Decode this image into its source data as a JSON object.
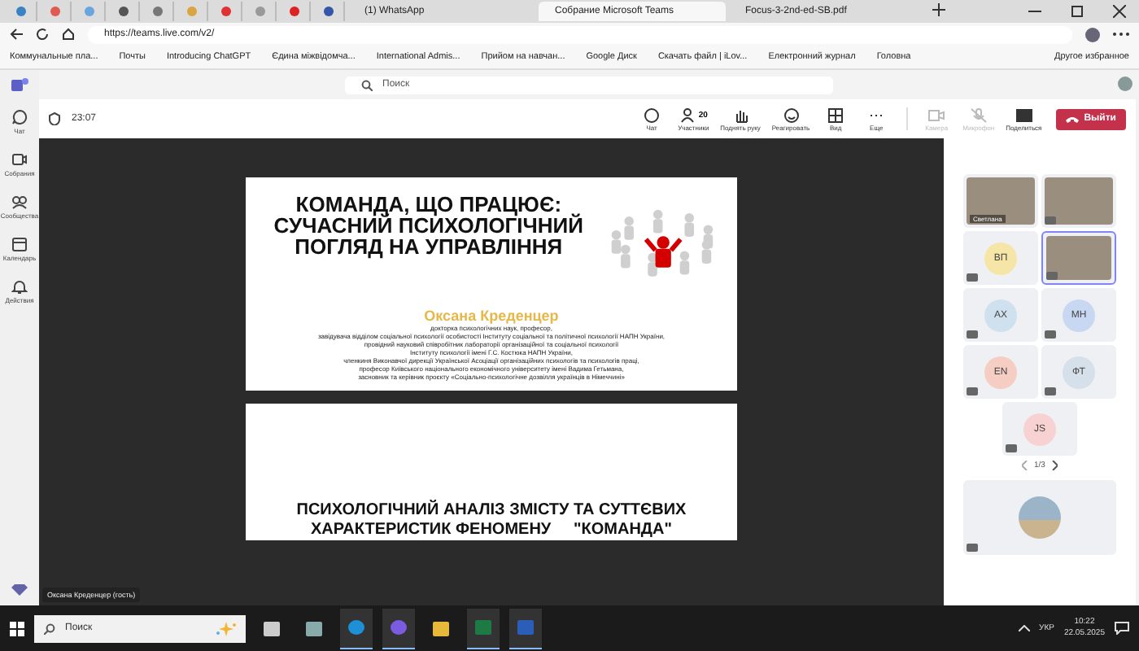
{
  "browser": {
    "tabs": [
      {
        "kind": "pinned",
        "selected": false
      },
      {
        "kind": "pinned",
        "selected": false
      },
      {
        "kind": "pinned",
        "selected": false
      },
      {
        "kind": "pinned",
        "selected": false
      },
      {
        "kind": "pinned",
        "selected": false
      },
      {
        "kind": "pinned",
        "selected": false
      },
      {
        "kind": "pinned",
        "selected": false
      },
      {
        "kind": "pinned",
        "selected": false
      },
      {
        "kind": "pinned",
        "selected": false
      },
      {
        "kind": "pinned",
        "selected": false
      },
      {
        "kind": "page",
        "label": "(1) WhatsApp",
        "selected": false
      },
      {
        "kind": "page",
        "label": "Собрание Microsoft Teams",
        "selected": true
      },
      {
        "kind": "page",
        "label": "Focus-3-2nd-ed-SB.pdf",
        "selected": false
      }
    ],
    "address": "https://teams.live.com/v2/",
    "bookmarks": [
      "Коммунальные пла...",
      "Почты",
      "Introducing ChatGPT",
      "Єдина міжвідомча...",
      "International Admis...",
      "Прийом на навчан...",
      "Google Диск",
      "Скачать файл | iLov...",
      "Електронний журнал",
      "Головна"
    ],
    "other_bookmarks": "Другое избранное"
  },
  "teams": {
    "search": {
      "placeholder": "Поиск"
    },
    "rail": [
      {
        "kind": "chat",
        "label": "Чат"
      },
      {
        "kind": "meet",
        "label": "Собрания"
      },
      {
        "kind": "community",
        "label": "Сообщества"
      },
      {
        "kind": "calendar",
        "label": "Календарь"
      },
      {
        "kind": "bell",
        "label": "Действия"
      }
    ],
    "timer": "23:07",
    "toolbar": [
      {
        "kind": "chat",
        "label": "Чат",
        "disabled": false
      },
      {
        "kind": "people",
        "label": "Участники",
        "count": "20",
        "disabled": false
      },
      {
        "kind": "hand",
        "label": "Поднять руку",
        "disabled": false
      },
      {
        "kind": "smile",
        "label": "Реагировать",
        "disabled": false
      },
      {
        "kind": "grid",
        "label": "Вид",
        "disabled": false
      },
      {
        "kind": "more",
        "label": "Еще",
        "disabled": false
      },
      {
        "kind": "camera",
        "label": "Камера",
        "disabled": true
      },
      {
        "kind": "mic",
        "label": "Микрофон",
        "disabled": true
      },
      {
        "kind": "share",
        "label": "Поделиться",
        "disabled": false
      }
    ],
    "leave": "Выйти",
    "slides": [
      {
        "title": "КОМАНДА, ЩО ПРАЦЮЄ: СУЧАСНИЙ ПСИХОЛОГІЧНИЙ ПОГЛЯД НА УПРАВЛІННЯ",
        "author": "Оксана Креденцер",
        "lines": [
          "докторка психологічних наук, професор,",
          "завідувача відділом соціальної психології особистості Інституту соціальної та політичної психології НАПН України,",
          "провідний науковий співробітник лабораторії організаційної та соціальної психології",
          "Інституту психології імені Г.С. Костюка НАПН України,",
          "членкиня Виконавчої дирекції Української Асоціації організаційних психологів та психологів праці,",
          "професор Київського національного економічного університету імені Вадима Гетьмана,",
          "засновник та керівник проєкту «Соціально-психологічне дозвілля українців в Німеччині»"
        ]
      },
      {
        "title": "ПСИХОЛОГІЧНИЙ АНАЛІЗ ЗМІСТУ ТА СУТТЄВИХ ХАРАКТЕРИСТИК ФЕНОМЕНУ     \"КОМАНДА\""
      }
    ],
    "presenter": "Оксана Креденцер (гость)",
    "participants": [
      {
        "kind": "video",
        "name": "Светлана"
      },
      {
        "kind": "video"
      },
      {
        "kind": "initials",
        "initials": "ВП",
        "color": "#f5e6a8"
      },
      {
        "kind": "video",
        "selected": true
      },
      {
        "kind": "initials",
        "initials": "АХ",
        "color": "#cfe0ef"
      },
      {
        "kind": "initials",
        "initials": "МН",
        "color": "#c9d8f2"
      },
      {
        "kind": "initials",
        "initials": "EN",
        "color": "#f6cdc3"
      },
      {
        "kind": "initials",
        "initials": "ФТ",
        "color": "#d6e0ea"
      },
      {
        "kind": "initials",
        "initials": "JS",
        "color": "#f8d2d2"
      }
    ],
    "pager": "1/3"
  },
  "taskbar": {
    "search": "Поиск",
    "language": "УКР",
    "time": "10:22",
    "date": "22.05.2025"
  }
}
